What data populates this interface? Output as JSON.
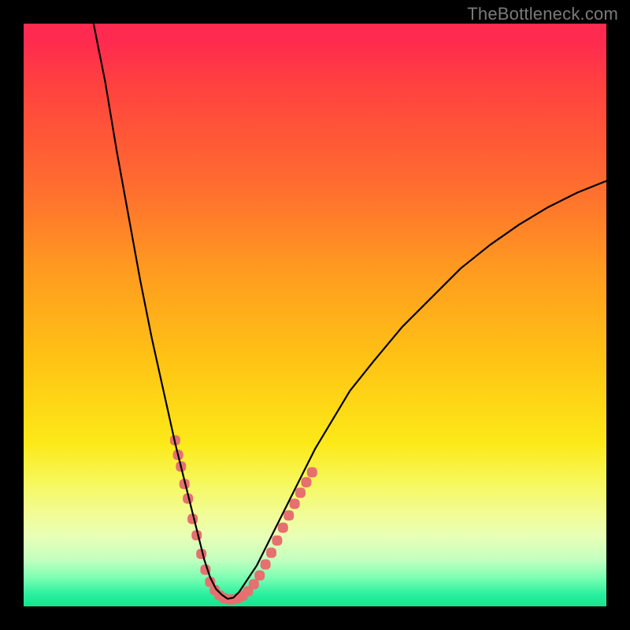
{
  "watermark": "TheBottleneck.com",
  "chart_data": {
    "type": "line",
    "title": "",
    "xlabel": "",
    "ylabel": "",
    "xlim": [
      0,
      100
    ],
    "ylim": [
      0,
      100
    ],
    "grid": false,
    "series": [
      {
        "name": "bottleneck-curve",
        "color": "#000000",
        "x": [
          12,
          14,
          16,
          18,
          20,
          22,
          24,
          26,
          27,
          28,
          29,
          30,
          31,
          32,
          33,
          34,
          35,
          36,
          37,
          38,
          40,
          42,
          44,
          46,
          48,
          50,
          53,
          56,
          60,
          65,
          70,
          75,
          80,
          85,
          90,
          95,
          100
        ],
        "y": [
          100,
          90,
          78,
          67,
          56,
          46,
          37,
          28,
          24,
          20,
          16,
          12,
          8,
          5,
          3,
          2,
          1.3,
          1.5,
          2.5,
          4,
          7,
          11,
          15,
          19,
          23,
          27,
          32,
          37,
          42,
          48,
          53,
          58,
          62,
          65.5,
          68.5,
          71,
          73
        ]
      }
    ],
    "markers": [
      {
        "name": "pink-dots-left",
        "color": "#e6706f",
        "shape": "rounded",
        "points": [
          {
            "x": 26,
            "y": 28.5
          },
          {
            "x": 26.5,
            "y": 26
          },
          {
            "x": 27,
            "y": 24
          },
          {
            "x": 27.6,
            "y": 21
          },
          {
            "x": 28.2,
            "y": 18.5
          },
          {
            "x": 29,
            "y": 15
          },
          {
            "x": 29.7,
            "y": 12.2
          },
          {
            "x": 30.5,
            "y": 9
          },
          {
            "x": 31.2,
            "y": 6.3
          },
          {
            "x": 32,
            "y": 4.2
          },
          {
            "x": 32.8,
            "y": 2.8
          },
          {
            "x": 33.6,
            "y": 1.9
          },
          {
            "x": 34.4,
            "y": 1.4
          }
        ]
      },
      {
        "name": "pink-dots-bottom",
        "color": "#e6706f",
        "shape": "rounded",
        "points": [
          {
            "x": 35.2,
            "y": 1.2
          },
          {
            "x": 36,
            "y": 1.2
          },
          {
            "x": 36.8,
            "y": 1.4
          },
          {
            "x": 37.6,
            "y": 1.8
          },
          {
            "x": 38.5,
            "y": 2.6
          },
          {
            "x": 39.5,
            "y": 3.8
          }
        ]
      },
      {
        "name": "pink-dots-right",
        "color": "#e6706f",
        "shape": "rounded",
        "points": [
          {
            "x": 40.5,
            "y": 5.3
          },
          {
            "x": 41.5,
            "y": 7.2
          },
          {
            "x": 42.5,
            "y": 9.2
          },
          {
            "x": 43.5,
            "y": 11.3
          },
          {
            "x": 44.5,
            "y": 13.5
          },
          {
            "x": 45.5,
            "y": 15.6
          },
          {
            "x": 46.5,
            "y": 17.6
          },
          {
            "x": 47.5,
            "y": 19.5
          },
          {
            "x": 48.5,
            "y": 21.3
          },
          {
            "x": 49.5,
            "y": 23
          }
        ]
      }
    ]
  }
}
